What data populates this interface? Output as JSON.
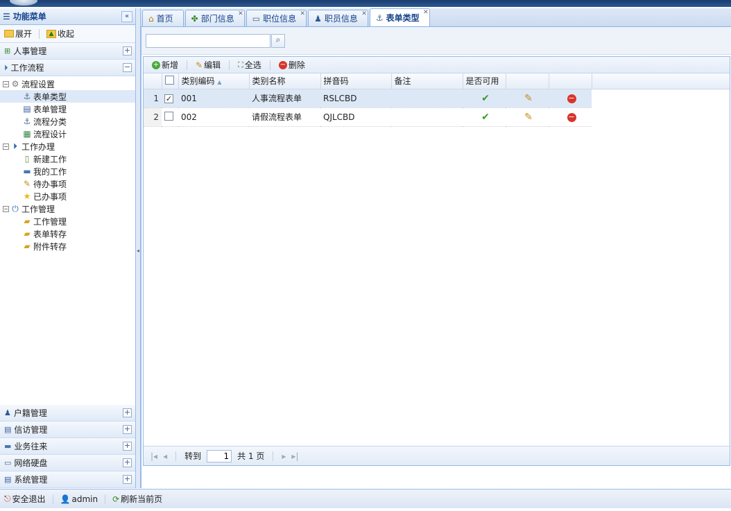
{
  "sidebar": {
    "title": "功能菜单",
    "expand_label": "展开",
    "collapse_label": "收起",
    "top_sections": [
      "人事管理",
      "工作流程"
    ],
    "tree": [
      {
        "label": "流程设置",
        "level": 0,
        "selected": false,
        "icon": "gear-icon"
      },
      {
        "label": "表单类型",
        "level": 1,
        "selected": true,
        "icon": "anchor-icon"
      },
      {
        "label": "表单管理",
        "level": 1,
        "selected": false,
        "icon": "form-icon"
      },
      {
        "label": "流程分类",
        "level": 1,
        "selected": false,
        "icon": "anchor-icon"
      },
      {
        "label": "流程设计",
        "level": 1,
        "selected": false,
        "icon": "design-icon"
      },
      {
        "label": "工作办理",
        "level": 0,
        "selected": false,
        "icon": "play-icon"
      },
      {
        "label": "新建工作",
        "level": 1,
        "selected": false,
        "icon": "new-doc-icon"
      },
      {
        "label": "我的工作",
        "level": 1,
        "selected": false,
        "icon": "list-icon"
      },
      {
        "label": "待办事项",
        "level": 1,
        "selected": false,
        "icon": "pencil-icon"
      },
      {
        "label": "已办事项",
        "level": 1,
        "selected": false,
        "icon": "star-icon"
      },
      {
        "label": "工作管理",
        "level": 0,
        "selected": false,
        "icon": "power-icon"
      },
      {
        "label": "工作管理",
        "level": 1,
        "selected": false,
        "icon": "folder-edit-icon"
      },
      {
        "label": "表单转存",
        "level": 1,
        "selected": false,
        "icon": "folder-export-icon"
      },
      {
        "label": "附件转存",
        "level": 1,
        "selected": false,
        "icon": "folder-export-icon"
      }
    ],
    "bottom_sections": [
      "户籍管理",
      "信访管理",
      "业务往来",
      "网络硬盘",
      "系统管理"
    ]
  },
  "tabs": [
    {
      "label": "首页",
      "icon": "home-icon",
      "closable": false,
      "active": false
    },
    {
      "label": "部门信息",
      "icon": "puzzle-icon",
      "closable": true,
      "active": false
    },
    {
      "label": "职位信息",
      "icon": "card-icon",
      "closable": true,
      "active": false
    },
    {
      "label": "职员信息",
      "icon": "user-icon",
      "closable": true,
      "active": false
    },
    {
      "label": "表单类型",
      "icon": "anchor-icon",
      "closable": true,
      "active": true
    }
  ],
  "search": {
    "value": ""
  },
  "toolbar": {
    "add": "新增",
    "edit": "编辑",
    "select_all": "全选",
    "delete": "删除"
  },
  "grid": {
    "columns": [
      "类别编码",
      "类别名称",
      "拼音码",
      "备注",
      "是否可用"
    ],
    "sort_indicator": "▲",
    "rows": [
      {
        "num": "1",
        "checked": true,
        "code": "001",
        "name": "人事流程表单",
        "pinyin": "RSLCBD",
        "note": "",
        "enabled": true
      },
      {
        "num": "2",
        "checked": false,
        "code": "002",
        "name": "请假流程表单",
        "pinyin": "QJLCBD",
        "note": "",
        "enabled": true
      }
    ]
  },
  "pager": {
    "goto_label": "转到",
    "page_value": "1",
    "total_label": "共 1 页"
  },
  "statusbar": {
    "logout": "安全退出",
    "user": "admin",
    "refresh": "刷新当前页"
  },
  "colors": {
    "accent": "#15428b",
    "border": "#99bbe8",
    "selected_row": "#dde8f6",
    "ok_green": "#3a9b2a",
    "delete_red": "#d9342b"
  }
}
